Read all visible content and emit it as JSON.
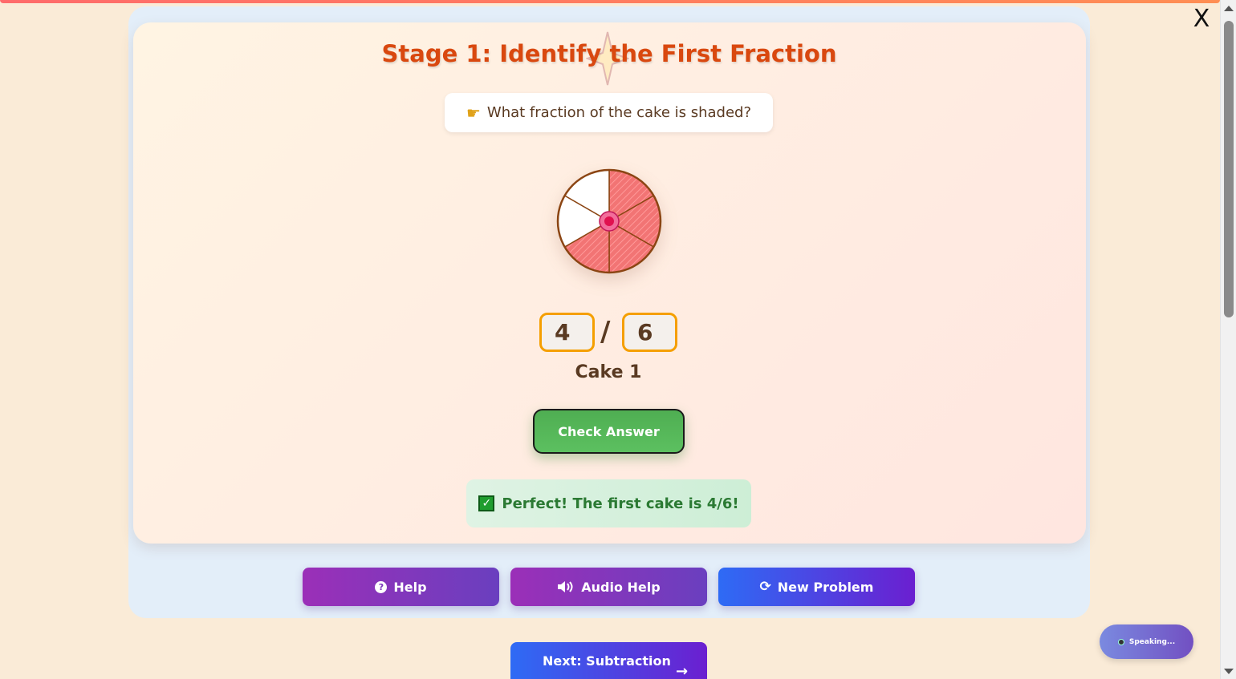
{
  "window": {
    "close_label": "X"
  },
  "stage": {
    "title": "Stage 1: Identify the First Fraction"
  },
  "question": {
    "text": "What fraction of the cake is shaded?",
    "icon": "pointing-hand-icon"
  },
  "cake": {
    "total_slices": 6,
    "shaded_slices": 4,
    "shaded_color": "#f07070",
    "label": "Cake 1"
  },
  "fraction": {
    "numerator": "4",
    "slash": "/",
    "denominator": "6"
  },
  "buttons": {
    "check": "Check Answer",
    "help": "Help",
    "audio_help": "Audio Help",
    "new_problem": "New Problem",
    "next": "Next: Subtraction"
  },
  "feedback": {
    "text": "Perfect! The first cake is 4/6!",
    "icon": "checkmark-icon"
  },
  "speaking_indicator": {
    "text": "Speaking..."
  },
  "colors": {
    "title": "#d9480f",
    "accent_green": "#4fae52",
    "accent_purple": "#9b2fb8",
    "accent_blue": "#2e6bf5"
  }
}
